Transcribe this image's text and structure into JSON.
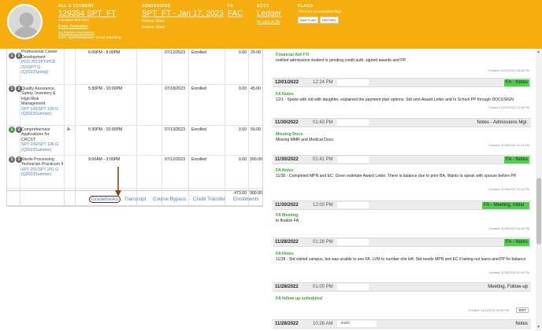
{
  "header": {
    "student": {
      "label": "ALL A STUDENT",
      "id_link": "129354 SPT_FT",
      "admitted": "Admitted 8/2/7023",
      "enter_retention": "Enter Retention",
      "ferpa": "No FERPA Permission",
      "sap": "SAP: Q2023Summer: Good Standing"
    },
    "admissions": {
      "label": "ADMISSIONS",
      "program_link": "SPT_FT - Jan 17, 2023",
      "status1": "Future Start",
      "status2": "Future Start"
    },
    "fa": {
      "label": "FA",
      "link": "FAC"
    },
    "acct": {
      "label": "ACCT",
      "link": "Ledger",
      "card": "No card on file"
    },
    "flags": {
      "label": "FLAGS",
      "message": "There are no unresolved flags",
      "add_button": "ADD FLAG",
      "history_button": "HISTORY"
    }
  },
  "courses": [
    {
      "badges": [
        "1",
        "2"
      ],
      "badge_green": false,
      "title": "Professional Career Development",
      "code": "PCD 201SPT/PCD 201SPT G (Q2023Spring)",
      "grade": "",
      "time": "6:00PM - 8:00PM",
      "date": "07/12/2023",
      "status": "Enrolled",
      "credits": "0.00",
      "amount": "20.00"
    },
    {
      "badges": [
        "1",
        "2"
      ],
      "badge_green": false,
      "title": "Quality Assurance, Safety, Inventory & High-Risk Management",
      "code": "SPT 105/SPT 105 G (Q2023Summer)",
      "grade": "",
      "time": "5:30PM - 10:00PM",
      "date": "07/18/2023",
      "status": "Enrolled",
      "credits": "0.00",
      "amount": "45.00"
    },
    {
      "badges": [
        "1",
        "2"
      ],
      "badge_green": true,
      "title": "Comprehensive Applications for CRCST",
      "code": "SPT 106/SPT 106 G (Q2023Summer)",
      "grade": "A-",
      "time": "5:30PM - 10:00PM",
      "date": "07/13/2023",
      "status": "Enrolled",
      "credits": "3.50",
      "amount": "50.00"
    },
    {
      "badges": [
        "1",
        "2"
      ],
      "badge_green": false,
      "title": "Sterile Processing Technician Practicum II",
      "code": "SPT 201/SPT 201 G (Q2023Summer)",
      "grade": "",
      "time": "9:00AM - 3:00PM",
      "date": "07/12/2023",
      "status": "Enrolled",
      "credits": "0.00",
      "amount": "300.00"
    }
  ],
  "totals": {
    "credits": "473.00",
    "amount": "900.00"
  },
  "tabs": [
    "Gradebooks",
    "Transcript",
    "Course Bypass",
    "Credit Transfer",
    "Enrollments"
  ],
  "notes": [
    {
      "body_title": "Financial Aid FYI",
      "body_text": "notified admissions student is pending credit auth, signed awards and PP",
      "created": "Created: 12/01/2022 03:26 PM",
      "date": "12/01/2022",
      "time": "12:24 PM",
      "type": "FA - Notes",
      "type_green": true
    },
    {
      "body_title": "FA Notes",
      "body_text": "12/1 - Spoke with std with daughter, explained the payment plan options. Std sent Award Letter and In School PP through DOCUSIGN",
      "created": "Created: 12/01/2022 12:26 PM",
      "date": "11/30/2022",
      "time": "01:43 PM",
      "type": "Notes - Admissions Mgr.",
      "type_green": false
    },
    {
      "body_title": "Missing Docs.",
      "body_text": "Missing MMR and Medical Docs.",
      "created": "Created: 11/30/2022 01:43 PM",
      "date": "11/30/2022",
      "time": "01:41 PM",
      "type": "FA - Notes",
      "type_green": true
    },
    {
      "body_title": "FA Notes",
      "body_text": "11/30 - Completed MPN and EC. Given estimate Award Letter. There is balance due to prior BA. Wants to speak with spouse before PP.",
      "created": "Created: 11/30/2022 01:41 PM",
      "date": "11/30/2022",
      "time": "12:00 PM",
      "type": "FA - Meeting, Initial",
      "type_green": true
    },
    {
      "body_title": "FA Meeting",
      "body_text": "to finalize FA",
      "created": "Created: 11/28/2022 04:26 PM",
      "date": "11/28/2022",
      "time": "01:26 PM",
      "type": "FA - Notes",
      "type_green": true
    },
    {
      "body_title": "FA Notes",
      "body_text": "11/28 - Std visited campus, but was unable to see FA. LVM to number she left. Std needs MPN and EC if taking out loans and PP for balance",
      "created": "Created: 11/28/2022 01:26 PM",
      "date": "11/28/2022",
      "time": "01:00 PM",
      "type": "Meeting, Follow-up",
      "type_green": false
    },
    {
      "body_title": "FA follow up scheduled",
      "body_text": "",
      "created": "Created: 11/11/2022 03:05 PM",
      "edit": "EDIT",
      "date": "11/28/2022",
      "time": "10:26 AM",
      "type": "Notes",
      "type_green": false,
      "author": ". Smith"
    }
  ]
}
